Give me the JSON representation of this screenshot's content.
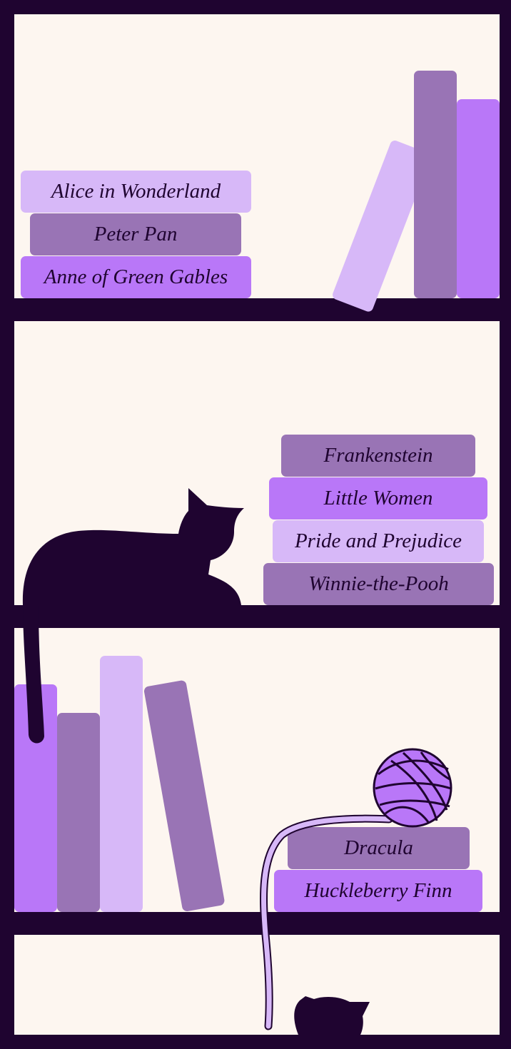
{
  "colors": {
    "frame": "#1f0430",
    "wall": "#fdf6f0",
    "book_light": "#d7b8f8",
    "book_mid": "#9974b5",
    "book_bright": "#b977f8"
  },
  "shelves": [
    {
      "stacked_books": [
        "Alice in Wonderland",
        "Peter Pan",
        "Anne of Green Gables"
      ]
    },
    {
      "stacked_books": [
        "Frankenstein",
        "Little Women",
        "Pride and Prejudice",
        "Winnie-the-Pooh"
      ]
    },
    {
      "stacked_books": [
        "Dracula",
        "Huckleberry Finn"
      ]
    }
  ],
  "decorations": [
    "cat-silhouette",
    "yarn-ball-icon",
    "kitten-silhouette"
  ]
}
